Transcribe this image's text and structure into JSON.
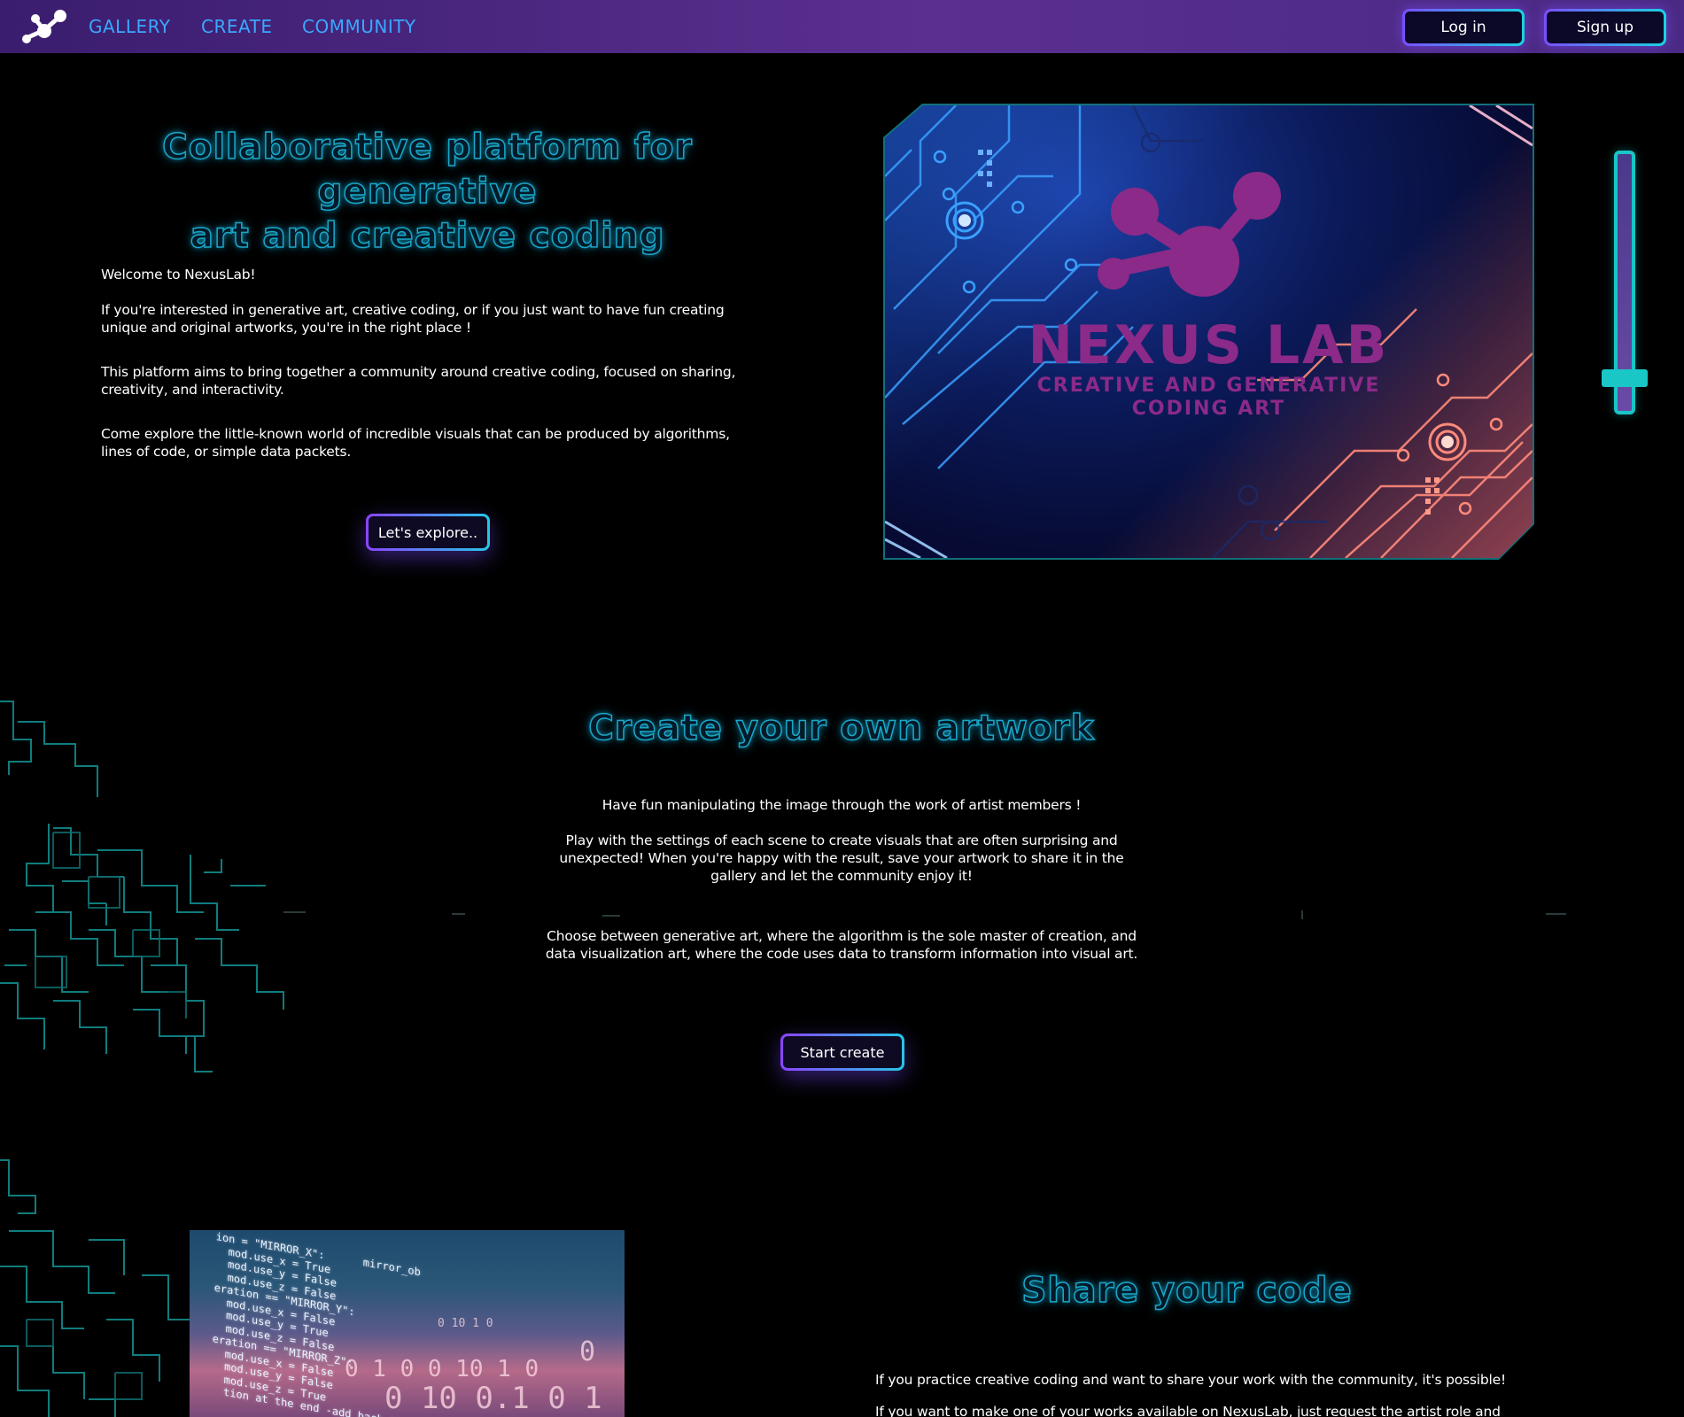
{
  "nav": {
    "links": [
      "GALLERY",
      "CREATE",
      "COMMUNITY"
    ],
    "login_label": "Log in",
    "signup_label": "Sign up"
  },
  "hero": {
    "title_line1": "Collaborative platform for generative",
    "title_line2": "art and creative coding",
    "welcome": "Welcome to NexusLab!",
    "p1": "If you're interested in generative art, creative coding, or if you just want to have fun creating unique and original artworks, you're in the right place !",
    "p2": "This platform aims to bring together a community around creative coding, focused on sharing, creativity, and interactivity.",
    "p3": "Come explore the little-known world of incredible visuals that can be produced by algorithms, lines of code, or simple data packets.",
    "cta_label": "Let's explore..",
    "image": {
      "brand_title": "NEXUS LAB",
      "brand_sub1": "CREATIVE AND GENERATIVE",
      "brand_sub2": "CODING ART"
    }
  },
  "create_section": {
    "title": "Create your own artwork",
    "p1": "Have fun manipulating the image through the work of artist members !",
    "p2": "Play with the settings of each scene to create visuals that are often surprising and unexpected! When you're happy with the result, save your artwork to share it in the gallery and let the community enjoy it!",
    "p3": "Choose between generative art, where the algorithm is the sole master of creation, and data visualization art, where the code uses data to transform information into visual art.",
    "cta_label": "Start create"
  },
  "share_section": {
    "title": "Share your code",
    "p1": "If you practice creative coding and want to share your work with the community, it's possible!",
    "p2": "If you want to make one of your works available on NexusLab, just request the artist role and you'll"
  },
  "colors": {
    "nav_bg_start": "#3a1d6e",
    "nav_bg_end": "#5a2f8f",
    "nav_link": "#3aa8ff",
    "neon_cyan": "#1aa7c8",
    "accent_purple": "#8a44ff",
    "accent_teal": "#19c7c7",
    "brand_magenta": "#8b2a88"
  },
  "icons": [
    "nexus-logo-icon",
    "slider-icon"
  ]
}
